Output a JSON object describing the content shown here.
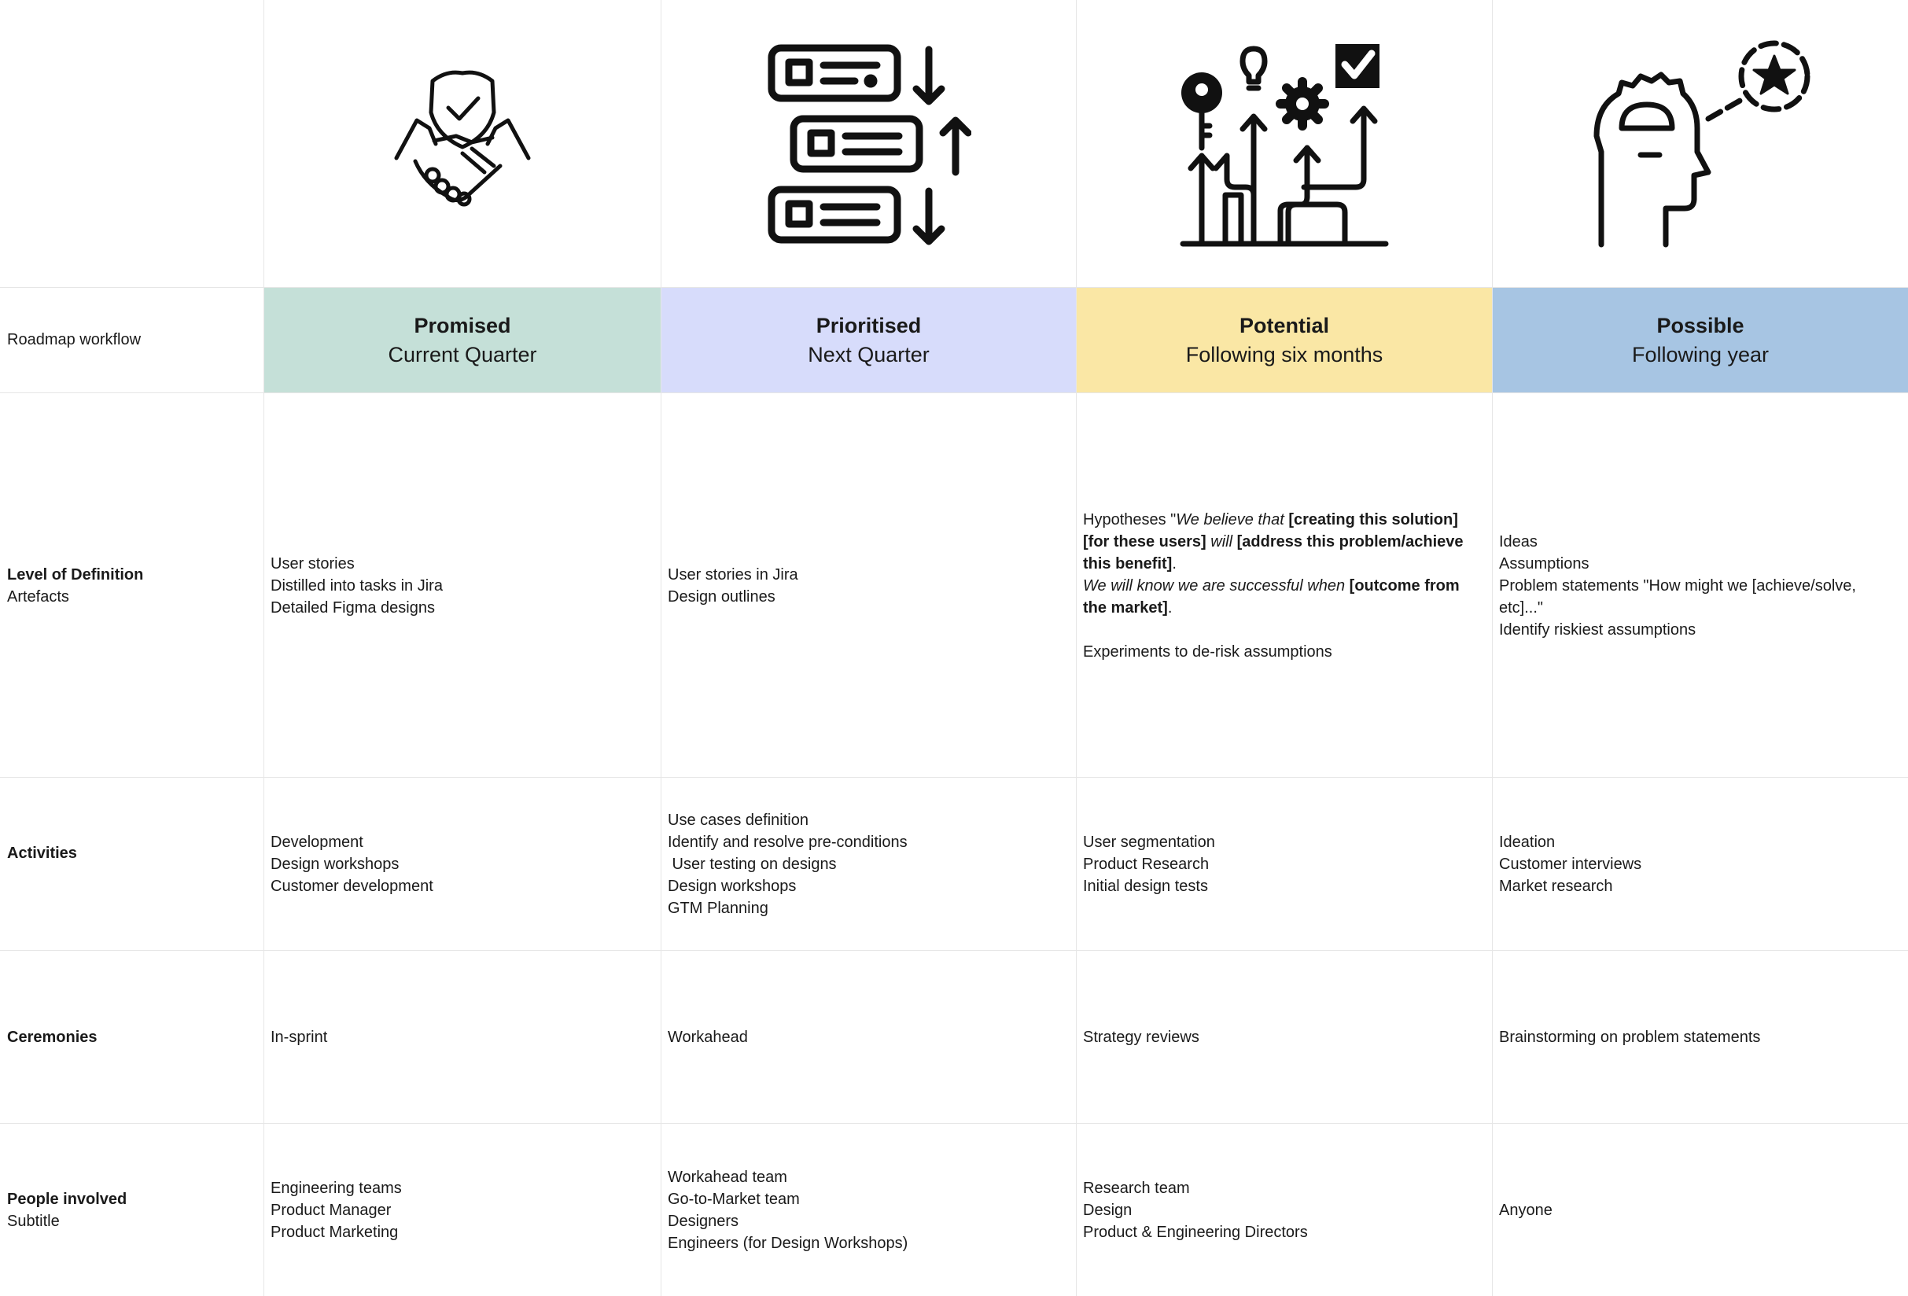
{
  "header_row_label": "Roadmap workflow",
  "columns": [
    {
      "title": "Promised",
      "subtitle": "Current Quarter",
      "color": "#c5e0d8",
      "icon": "handshake-shield-icon"
    },
    {
      "title": "Prioritised",
      "subtitle": "Next Quarter",
      "color": "#d7dcfb",
      "icon": "sorted-list-arrows-icon"
    },
    {
      "title": "Potential",
      "subtitle": "Following six months",
      "color": "#fae7a5",
      "icon": "paths-ideas-icon"
    },
    {
      "title": "Possible",
      "subtitle": "Following year",
      "color": "#a7c5e3",
      "icon": "head-star-icon"
    }
  ],
  "rows": {
    "definition": {
      "label": "Level of Definition",
      "sublabel": "Artefacts",
      "promised": [
        "User stories",
        "Distilled into tasks in Jira",
        "Detailed Figma designs"
      ],
      "prioritised": [
        "User stories in Jira",
        "Design outlines"
      ],
      "potential": {
        "p1": "Hypotheses \"",
        "p2": "We believe that",
        "p3": " [creating this solution] [for these users]",
        "p4": " will ",
        "p5": " [address this problem/achieve this benefit]",
        "p6": ".",
        "p7": "We will know we are successful when",
        "p8": " [outcome from the market]",
        "p9": ".",
        "p10": "Experiments to de-risk assumptions"
      },
      "possible": [
        "Ideas",
        "Assumptions",
        "Problem statements \"How might we [achieve/solve, etc]...\"",
        "Identify riskiest assumptions"
      ]
    },
    "activities": {
      "label": "Activities",
      "promised": [
        "Development",
        "Design workshops",
        "Customer development"
      ],
      "prioritised": [
        "Use cases definition",
        "Identify and resolve pre-conditions",
        " User testing on designs",
        "Design workshops",
        "GTM Planning"
      ],
      "potential": [
        "User segmentation",
        "Product Research",
        "Initial design tests"
      ],
      "possible": [
        "Ideation",
        "Customer interviews",
        "Market research"
      ]
    },
    "ceremonies": {
      "label": "Ceremonies",
      "promised": "In-sprint",
      "prioritised": "Workahead",
      "potential": "Strategy reviews",
      "possible": "Brainstorming on problem statements"
    },
    "people": {
      "label": "People involved",
      "sublabel": "Subtitle",
      "promised": [
        "Engineering teams",
        "Product Manager",
        "Product Marketing"
      ],
      "prioritised": [
        "Workahead team",
        "Go-to-Market team",
        "Designers",
        "Engineers (for Design Workshops)"
      ],
      "potential": [
        "Research team",
        "Design",
        "Product & Engineering Directors"
      ],
      "possible": [
        "Anyone"
      ]
    }
  }
}
